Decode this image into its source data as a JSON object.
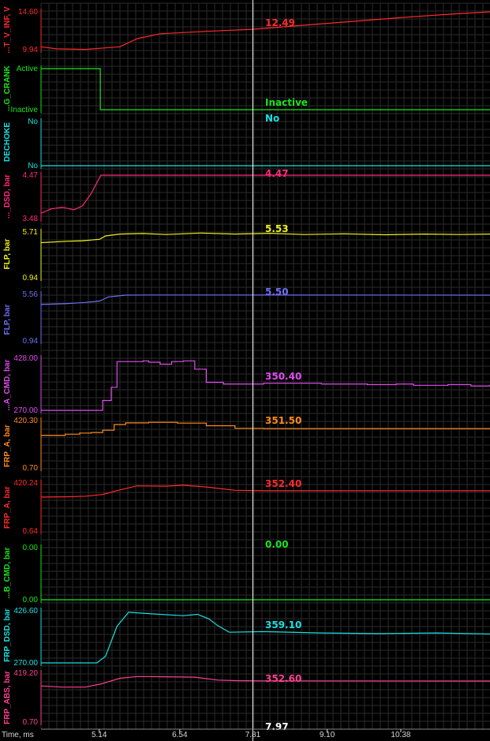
{
  "chart_data": {
    "type": "line",
    "x_axis": {
      "label": "Time, ms",
      "ticks": [
        "5.14",
        "6.54",
        "7.81",
        "9.10",
        "10.38"
      ],
      "tick_values": [
        5.14,
        6.54,
        7.81,
        9.1,
        10.38
      ],
      "range": [
        4.13,
        11.93
      ],
      "cursor": 7.81,
      "cursor_label": "7.97"
    },
    "grid": true,
    "panels": [
      {
        "name": "...G_CRANK",
        "color": "#19e619",
        "y_ticks": [
          "Active",
          "Inactive"
        ],
        "range": [
          0,
          1
        ],
        "cursor_value": "Inactive",
        "series": {
          "x": [
            4.13,
            5.14,
            5.16,
            11.93
          ],
          "y": [
            1,
            1,
            0,
            0
          ],
          "step": true
        }
      },
      {
        "name": "DECHOKE",
        "color": "#18e0e0",
        "y_ticks": [
          "No",
          "No"
        ],
        "range": [
          0,
          1
        ],
        "cursor_value": "No",
        "series": {
          "x": [
            4.13,
            11.93
          ],
          "y": [
            0,
            0
          ],
          "step": true
        }
      },
      {
        "name": "..._DSD, bar",
        "color": "#ff2a7a",
        "y_ticks": [
          "4.47",
          "3.48"
        ],
        "range": [
          3.48,
          4.47
        ],
        "cursor_value": "4.47",
        "series": {
          "x": [
            4.13,
            4.3,
            4.5,
            4.7,
            4.85,
            5.0,
            5.08,
            5.17,
            11.93
          ],
          "y": [
            3.6,
            3.7,
            3.74,
            3.68,
            3.77,
            4.05,
            4.25,
            4.47,
            4.47
          ],
          "step": false
        }
      },
      {
        "name": "FLP, bar",
        "color": "#f0f020",
        "y_ticks": [
          "5.71",
          "0.94"
        ],
        "range": [
          0.94,
          5.71
        ],
        "cursor_value": "5.53",
        "series": {
          "x": [
            4.13,
            4.6,
            4.85,
            5.15,
            5.25,
            5.5,
            5.9,
            6.3,
            6.9,
            7.5,
            8.1,
            8.7,
            9.4,
            10.1,
            10.8,
            11.4,
            11.93
          ],
          "y": [
            4.6,
            4.75,
            4.8,
            4.95,
            5.3,
            5.5,
            5.55,
            5.45,
            5.6,
            5.5,
            5.58,
            5.45,
            5.52,
            5.42,
            5.5,
            5.45,
            5.5
          ],
          "step": false
        }
      },
      {
        "name": "FLP, bar",
        "color": "#6f6ff5",
        "y_ticks": [
          "5.56",
          "0.94"
        ],
        "range": [
          0.94,
          5.56
        ],
        "cursor_value": "5.50",
        "series": {
          "x": [
            4.13,
            4.6,
            4.9,
            5.15,
            5.3,
            5.6,
            6.0,
            7.0,
            11.93
          ],
          "y": [
            4.55,
            4.65,
            4.75,
            4.9,
            5.3,
            5.48,
            5.5,
            5.5,
            5.48
          ],
          "step": false
        }
      },
      {
        "name": "...A_CMD, bar",
        "color": "#e04bf0",
        "y_ticks": [
          "428.00",
          "270.00"
        ],
        "range": [
          270.0,
          428.0
        ],
        "cursor_value": "350.40",
        "series": {
          "x": [
            4.13,
            5.1,
            5.2,
            5.35,
            5.45,
            5.9,
            6.0,
            6.2,
            6.4,
            6.6,
            6.8,
            7.0,
            7.3,
            8.0,
            9.0,
            9.8,
            10.3,
            10.6,
            11.2,
            11.6,
            11.93
          ],
          "y": [
            270,
            270,
            300,
            340,
            418,
            420,
            416,
            410,
            418,
            420,
            395,
            355,
            350,
            352,
            350,
            348,
            350,
            346,
            348,
            344,
            348
          ],
          "step": true
        }
      },
      {
        "name": "FRP_A, bar",
        "color": "#ff8a1a",
        "y_ticks": [
          "420.30",
          "0.70"
        ],
        "range": [
          0.7,
          420.3
        ],
        "cursor_value": "351.50",
        "series": {
          "x": [
            4.13,
            4.55,
            4.8,
            5.0,
            5.2,
            5.4,
            5.6,
            6.0,
            6.5,
            7.0,
            7.5,
            8.0,
            11.93
          ],
          "y": [
            290,
            300,
            310,
            315,
            335,
            385,
            400,
            405,
            398,
            375,
            352,
            350,
            350
          ],
          "step": true
        }
      },
      {
        "name": "FRP_A, bar",
        "color": "#ff2a2a",
        "y_ticks": [
          "420.24",
          "0.64"
        ],
        "range": [
          0.64,
          420.24
        ],
        "cursor_value": "352.40",
        "series": {
          "x": [
            4.13,
            4.6,
            4.9,
            5.2,
            5.5,
            5.8,
            6.3,
            6.6,
            7.0,
            7.5,
            8.0,
            11.93
          ],
          "y": [
            297,
            300,
            305,
            320,
            360,
            395,
            392,
            400,
            385,
            356,
            352,
            352
          ],
          "step": false
        }
      },
      {
        "name": "...B_CMD, bar",
        "color": "#19e619",
        "y_ticks": [
          "0.00",
          "0.00"
        ],
        "range": [
          0,
          1
        ],
        "cursor_value": "0.00",
        "series": {
          "x": [
            4.13,
            11.93
          ],
          "y": [
            0,
            0
          ],
          "step": false
        }
      },
      {
        "name": "FRP_DSD, bar",
        "color": "#18e0e0",
        "y_ticks": [
          "426.60",
          "270.00"
        ],
        "range": [
          270.0,
          426.6
        ],
        "cursor_value": "359.10",
        "series": {
          "x": [
            4.13,
            5.1,
            5.25,
            5.45,
            5.65,
            6.0,
            6.6,
            6.85,
            7.05,
            7.2,
            7.4,
            8.0,
            9.0,
            10.0,
            11.0,
            11.93
          ],
          "y": [
            270,
            270,
            290,
            380,
            422,
            418,
            412,
            416,
            402,
            382,
            362,
            364,
            360,
            358,
            360,
            357
          ],
          "step": false
        }
      },
      {
        "name": "FRP_ABS, bar",
        "color": "#ff3f8f",
        "y_ticks": [
          "419.20",
          "0.70"
        ],
        "range": [
          0.7,
          419.2
        ],
        "cursor_value": "352.60",
        "series": {
          "x": [
            4.13,
            4.5,
            4.9,
            5.2,
            5.5,
            5.8,
            6.3,
            6.8,
            7.2,
            7.5,
            8.0,
            11.93
          ],
          "y": [
            310,
            300,
            300,
            330,
            375,
            390,
            388,
            385,
            360,
            355,
            353,
            352
          ],
          "step": false
        }
      }
    ],
    "top_panel": {
      "name": "...T_V_INF, V",
      "color": "#ff2a2a",
      "y_ticks": [
        "14.60",
        "9.94"
      ],
      "range": [
        9.94,
        14.6
      ],
      "cursor_value": "12.49",
      "series": {
        "x": [
          4.13,
          4.4,
          4.9,
          5.5,
          5.8,
          6.2,
          7.0,
          7.81,
          8.6,
          9.5,
          10.4,
          11.2,
          11.93
        ],
        "y": [
          10.3,
          10.05,
          9.98,
          10.3,
          11.3,
          11.9,
          12.2,
          12.45,
          12.9,
          13.4,
          13.9,
          14.3,
          14.6
        ]
      }
    }
  }
}
